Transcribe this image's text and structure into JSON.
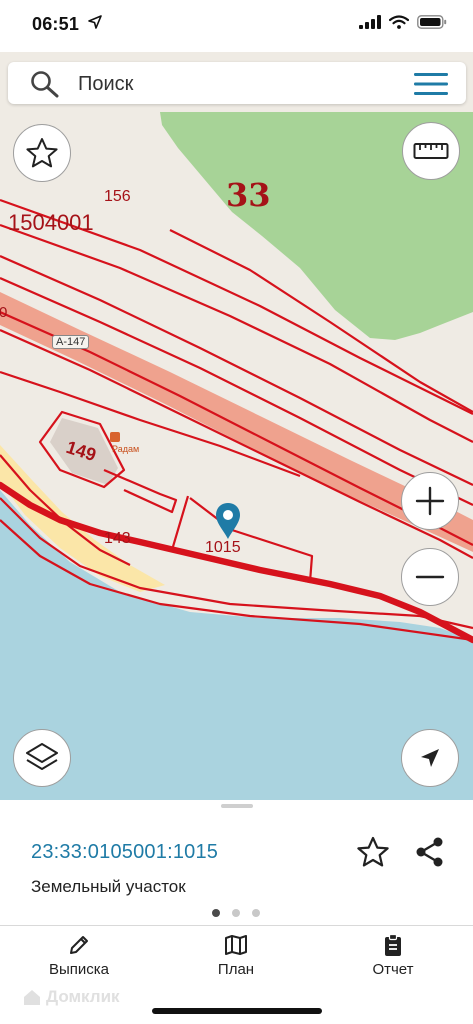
{
  "status_bar": {
    "time": "06:51",
    "icons": [
      "location-arrow-icon",
      "cellular-signal-icon",
      "wifi-icon",
      "battery-icon"
    ]
  },
  "search": {
    "placeholder": "Поиск",
    "icons": [
      "search-icon",
      "menu-icon"
    ]
  },
  "map": {
    "labels": {
      "block_33": "33",
      "parcel_156": "156",
      "quarter": "1504001",
      "road_sign": "А-147",
      "parcel_149": "149",
      "poi_name": "Радам",
      "parcel_143": "143",
      "parcel_1015": "1015",
      "edge_zero": "0"
    },
    "buttons": [
      "favorite-star-icon",
      "ruler-icon",
      "zoom-in-icon",
      "zoom-out-icon",
      "layers-icon",
      "navigation-arrow-icon"
    ],
    "colors": {
      "forest": "#a7d397",
      "land": "#efebe4",
      "water": "#aad3df",
      "highway": "#efa28e",
      "boundary": "#d6121c",
      "beach": "#fbe6a8",
      "marker": "#1f7ba6"
    }
  },
  "sheet": {
    "parcel_id": "23:33:0105001:1015",
    "parcel_type": "Земельный участок",
    "page_dots": {
      "count": 3,
      "active": 1
    }
  },
  "tabs": [
    {
      "label": "Выписка",
      "icon": "pencil-icon"
    },
    {
      "label": "План",
      "icon": "map-icon"
    },
    {
      "label": "Отчет",
      "icon": "clipboard-icon"
    }
  ],
  "watermark": "Домклик"
}
